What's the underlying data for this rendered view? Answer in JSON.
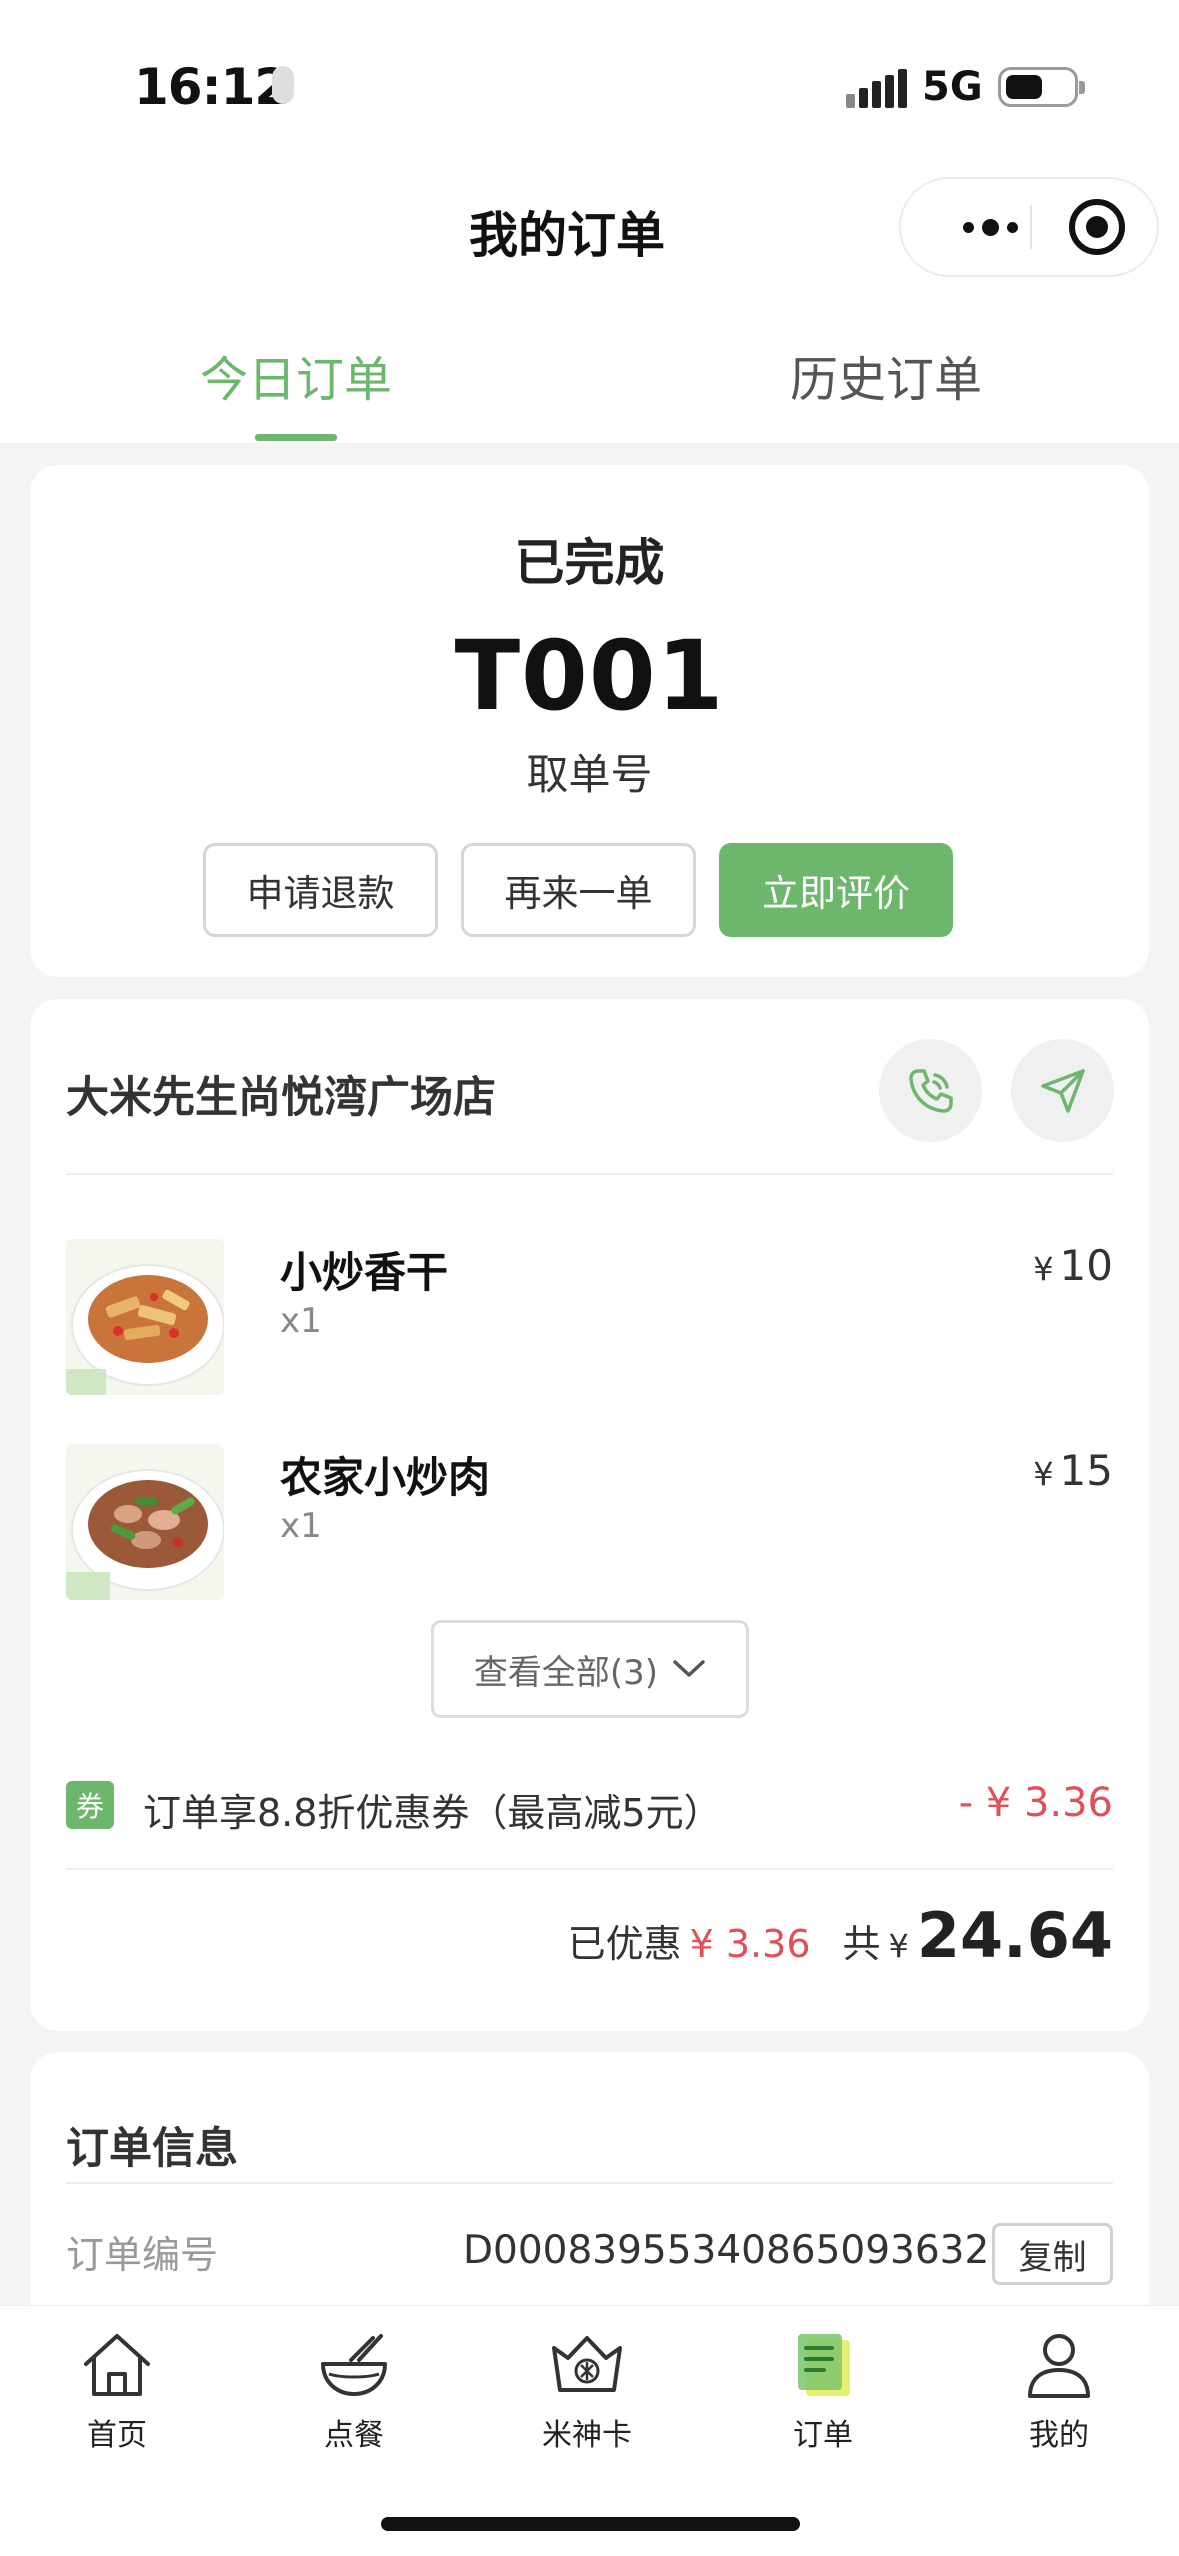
{
  "status_bar": {
    "time": "16:12",
    "network": "5G"
  },
  "nav": {
    "title": "我的订单"
  },
  "tabs": {
    "today": "今日订单",
    "history": "历史订单"
  },
  "order_status": {
    "status": "已完成",
    "pickup_code": "T001",
    "pickup_label": "取单号",
    "buttons": {
      "refund": "申请退款",
      "reorder": "再来一单",
      "rate": "立即评价"
    }
  },
  "store": {
    "name": "大米先生尚悦湾广场店",
    "items": [
      {
        "name": "小炒香干",
        "qty": "x1",
        "currency": "¥",
        "price": "10"
      },
      {
        "name": "农家小炒肉",
        "qty": "x1",
        "currency": "¥",
        "price": "15"
      }
    ],
    "view_all": "查看全部(3)",
    "coupon": {
      "badge": "券",
      "text": "订单享8.8折优惠券（最高减5元）",
      "amount": "- ¥ 3.36"
    },
    "summary": {
      "discount_label": "已优惠",
      "discount": "¥ 3.36",
      "total_label": "共",
      "currency": "¥",
      "total": "24.64"
    }
  },
  "order_info": {
    "title": "订单信息",
    "order_no_label": "订单编号",
    "order_no": "D000839553408650936 32",
    "copy": "复制"
  },
  "tabbar": {
    "items": [
      {
        "label": "首页",
        "icon": "home-icon"
      },
      {
        "label": "点餐",
        "icon": "bowl-icon"
      },
      {
        "label": "米神卡",
        "icon": "crown-card-icon"
      },
      {
        "label": "订单",
        "icon": "order-icon"
      },
      {
        "label": "我的",
        "icon": "profile-icon"
      }
    ]
  },
  "colors": {
    "accent": "#6cb76b",
    "price_red": "#e0505a"
  }
}
